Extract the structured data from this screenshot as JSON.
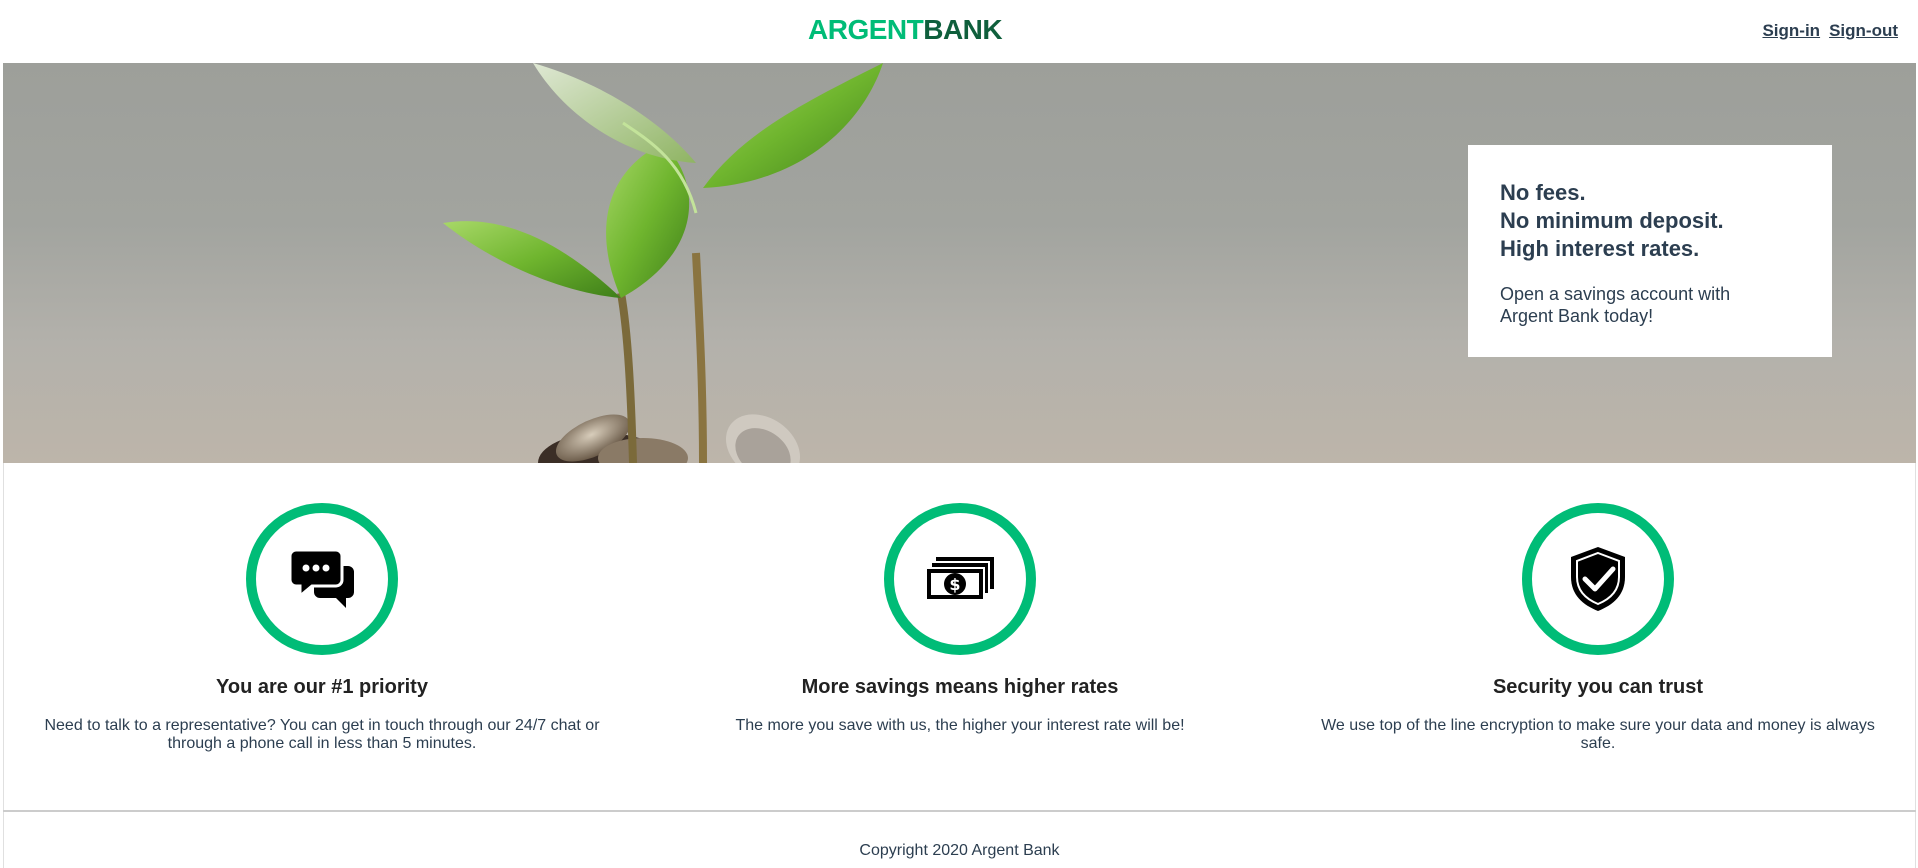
{
  "header": {
    "logo_part1": "ARGENT",
    "logo_part2": "BANK",
    "nav": {
      "sign_in": "Sign-in",
      "sign_out": "Sign-out"
    }
  },
  "hero": {
    "promo": {
      "line1": "No fees.",
      "line2": "No minimum deposit.",
      "line3": "High interest rates.",
      "subtitle": "Open a savings account with Argent Bank today!"
    }
  },
  "features": [
    {
      "icon": "chat-icon",
      "title": "You are our #1 priority",
      "text": "Need to talk to a representative? You can get in touch through our 24/7 chat or through a phone call in less than 5 minutes."
    },
    {
      "icon": "money-icon",
      "title": "More savings means higher rates",
      "text": "The more you save with us, the higher your interest rate will be!"
    },
    {
      "icon": "security-icon",
      "title": "Security you can trust",
      "text": "We use top of the line encryption to make sure your data and money is always safe."
    }
  ],
  "footer": {
    "copyright": "Copyright 2020 Argent Bank"
  },
  "colors": {
    "brand_green": "#00bc77",
    "brand_dark_green": "#0f5f3c",
    "text": "#2c3e50"
  }
}
